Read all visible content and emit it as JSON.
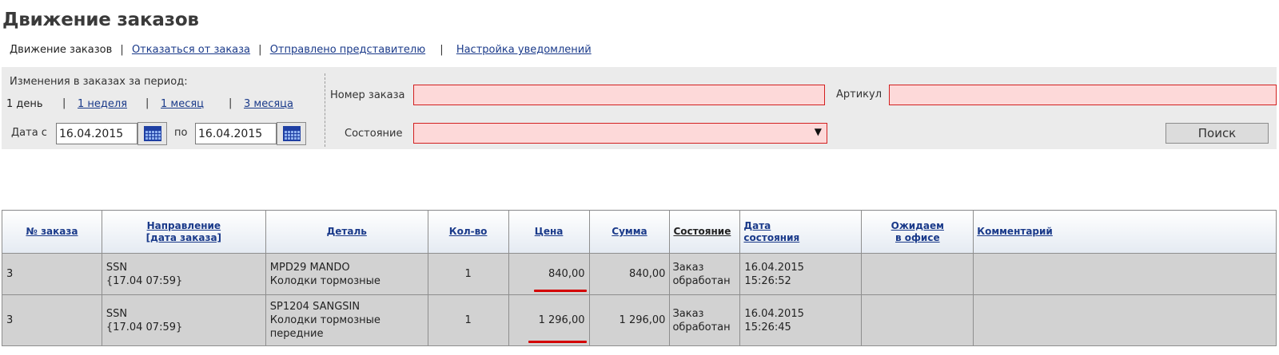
{
  "page": {
    "title": "Движение заказов"
  },
  "subnav": {
    "current": "Движение заказов",
    "separator": "|",
    "links": [
      "Отказаться от заказа",
      "Отправлено представителю",
      "Настройка уведомлений"
    ]
  },
  "filter": {
    "period_label": "Изменения в заказах за период:",
    "period_current": "1 день",
    "period_links": [
      "1 неделя",
      "1 месяц",
      "3 месяца"
    ],
    "date_from_label": "Дата с",
    "date_from": "16.04.2015",
    "date_to_label": "по",
    "date_to": "16.04.2015",
    "order_number_label": "Номер заказа",
    "order_number": "",
    "article_label": "Артикул",
    "article": "",
    "state_label": "Состояние",
    "state_value": "",
    "state_arrow": "▼",
    "search_button": "Поиск",
    "icons": {
      "calendar": "calendar-icon"
    }
  },
  "table": {
    "headers": {
      "order_no": "№ заказа",
      "direction_1": "Направление",
      "direction_2": "[дата заказа]",
      "detail": "Деталь",
      "qty": "Кол-во",
      "price": "Цена",
      "sum": "Сумма",
      "state": "Состояние",
      "state_date_1": "Дата",
      "state_date_2": "состояния",
      "expected_1": "Ожидаем",
      "expected_2": "в офисе",
      "comment": "Комментарий"
    },
    "rows": [
      {
        "order_no": "3",
        "direction": "SSN\n{17.04 07:59}",
        "detail": "MPD29 MANDO\nКолодки тормозные",
        "qty": "1",
        "price": "840,00",
        "sum": "840,00",
        "state": "Заказ\nобработан",
        "state_date": "16.04.2015\n15:26:52",
        "expected": "",
        "comment": ""
      },
      {
        "order_no": "3",
        "direction": "SSN\n{17.04 07:59}",
        "detail": "SP1204 SANGSIN\nКолодки тормозные\nпередние",
        "qty": "1",
        "price": "1 296,00",
        "sum": "1 296,00",
        "state": "Заказ\nобработан",
        "state_date": "16.04.2015\n15:26:45",
        "expected": "",
        "comment": ""
      }
    ]
  },
  "colors": {
    "link": "#1a3a8a",
    "invalid_field_border": "#d22020",
    "invalid_field_bg": "#fdd9d9",
    "highlight_underline": "#d40000",
    "row_bg": "#d2d2d2",
    "panel_bg": "#ebebeb"
  }
}
